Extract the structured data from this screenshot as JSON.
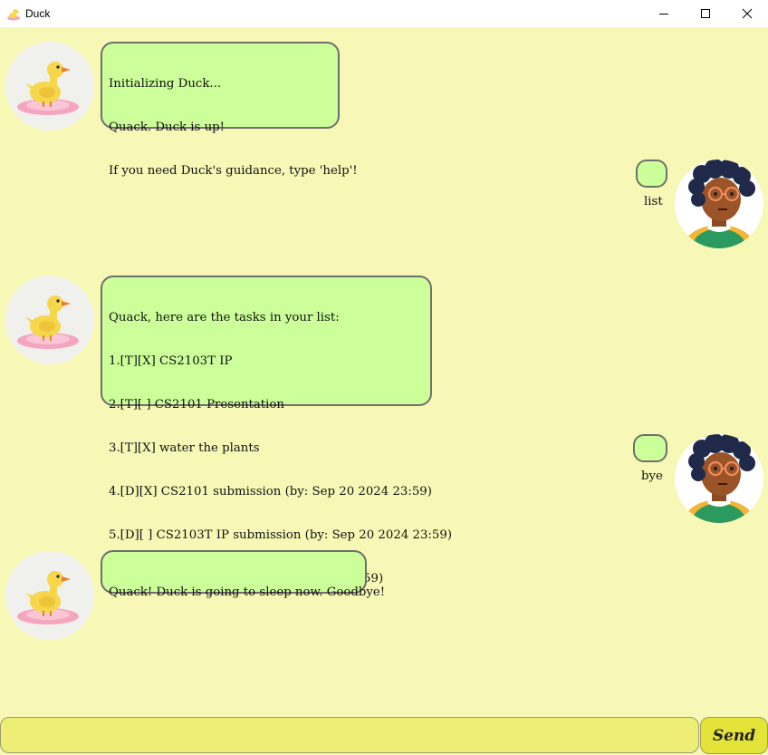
{
  "window": {
    "title": "Duck",
    "icon": "duck-app-icon",
    "controls": [
      "minimize-icon",
      "maximize-icon",
      "close-icon"
    ]
  },
  "messages": [
    {
      "sender": "duck",
      "avatar": "duck-avatar",
      "lines": [
        "Initializing Duck...",
        "Quack. Duck is up!",
        "If you need Duck's guidance, type 'help'!"
      ]
    },
    {
      "sender": "user",
      "avatar": "user-avatar",
      "lines": [
        "list"
      ]
    },
    {
      "sender": "duck",
      "avatar": "duck-avatar",
      "lines": [
        "Quack, here are the tasks in your list:",
        "1.[T][X] CS2103T IP",
        "2.[T][ ] CS2101 Presentation",
        "3.[T][X] water the plants",
        "4.[D][X] CS2101 submission (by: Sep 20 2024 23:59)",
        "5.[D][ ] CS2103T IP submission (by: Sep 20 2024 23:59)",
        "6.[D][ ] CS2103T TP (by: Sep 20 2024 23:59)"
      ]
    },
    {
      "sender": "user",
      "avatar": "user-avatar",
      "lines": [
        "bye"
      ]
    },
    {
      "sender": "duck",
      "avatar": "duck-avatar",
      "lines": [
        "Quack! Duck is going to sleep now. Goodbye!"
      ]
    }
  ],
  "input": {
    "value": "",
    "placeholder": ""
  },
  "send_button": {
    "label": "Send"
  },
  "colors": {
    "background": "#f7f7b6",
    "bubble": "#ccff99",
    "bubble_border": "#6f6f6f",
    "input": "#eeee77",
    "send": "#e3e33a"
  }
}
